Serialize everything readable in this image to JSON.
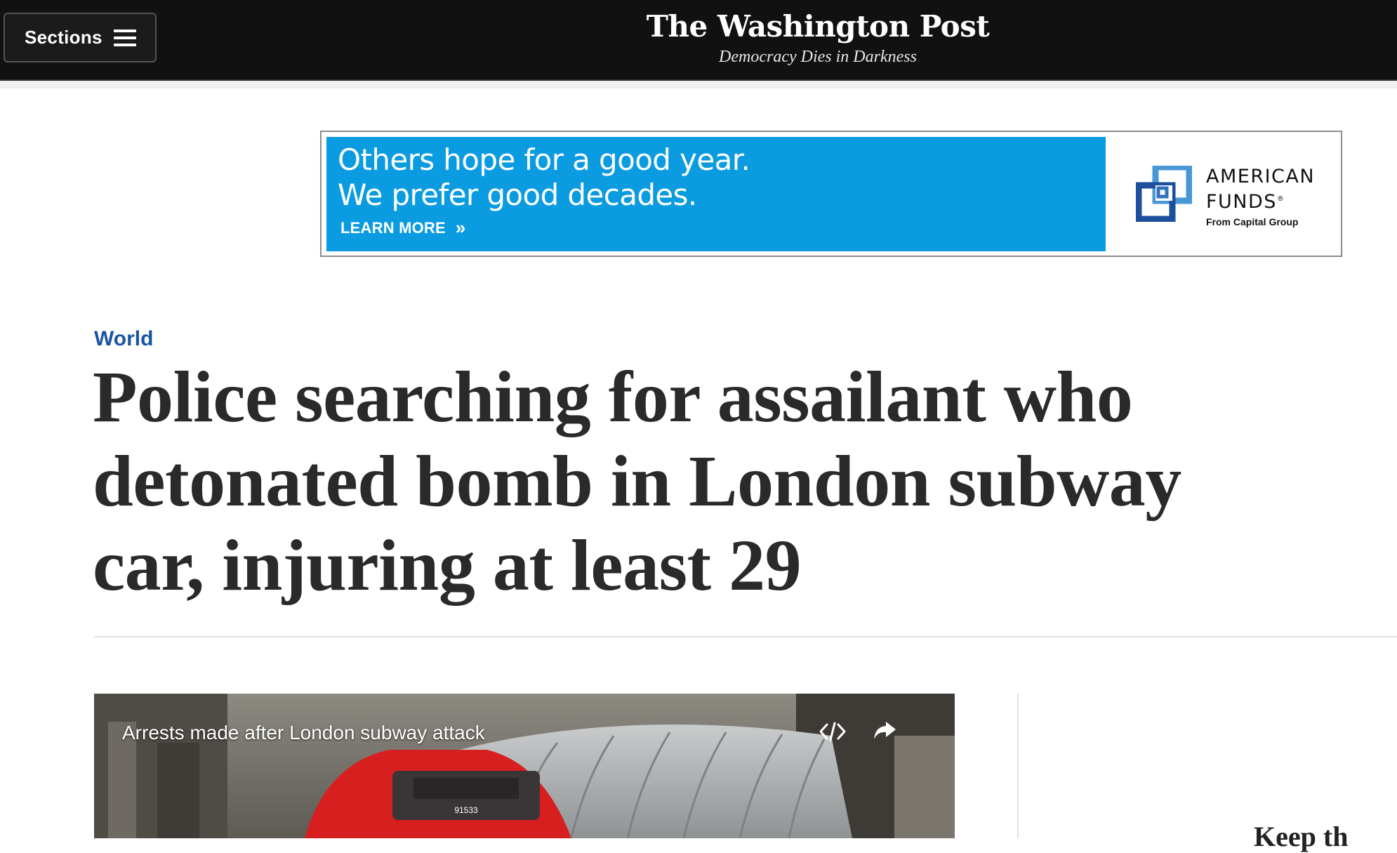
{
  "header": {
    "sections_label": "Sections",
    "masthead": "The Washington Post",
    "tagline": "Democracy Dies in Darkness",
    "bg_color": "#111111"
  },
  "ad": {
    "headline_line1": "Others hope for a good year.",
    "headline_line2": "We prefer good decades.",
    "cta": "LEARN MORE",
    "brand_line1": "AMERICAN",
    "brand_line2": "FUNDS",
    "brand_mark": "®",
    "brand_sub": "From Capital Group",
    "bg_color": "#0a9be0",
    "logo_icon": "american-funds-logo-icon"
  },
  "article": {
    "kicker": "World",
    "kicker_color": "#1955a5",
    "headline": "Police searching for assailant who detonated bomb in London subway car, injuring at least 29"
  },
  "video": {
    "title": "Arrests made after London subway attack",
    "embed_icon": "embed-code-icon",
    "share_icon": "share-arrow-icon"
  },
  "rail": {
    "partial_heading": "Keep th"
  }
}
